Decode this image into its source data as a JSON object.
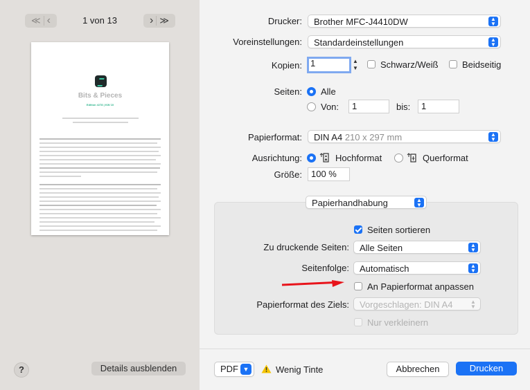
{
  "nav": {
    "first": "≪",
    "prev": "‹",
    "next": "›",
    "last": "≫",
    "page_indicator": "1 von 13"
  },
  "preview": {
    "title": "Bits & Pieces",
    "subtitle": "Edition #278 | KW 10"
  },
  "left_footer": {
    "help": "?",
    "details_button": "Details ausblenden"
  },
  "printer": {
    "label": "Drucker:",
    "value": "Brother MFC-J4410DW"
  },
  "presets": {
    "label": "Voreinstellungen:",
    "value": "Standardeinstellungen"
  },
  "copies": {
    "label": "Kopien:",
    "value": "1",
    "bw_label": "Schwarz/Weiß",
    "duplex_label": "Beidseitig"
  },
  "pages": {
    "label": "Seiten:",
    "all_label": "Alle",
    "from_label": "Von:",
    "from_value": "1",
    "to_label": "bis:",
    "to_value": "1"
  },
  "paper": {
    "label": "Papierformat:",
    "value": "DIN A4",
    "dims": "210 x 297 mm"
  },
  "orientation": {
    "label": "Ausrichtung:",
    "portrait": "Hochformat",
    "landscape": "Querformat"
  },
  "scale": {
    "label": "Größe:",
    "value": "100 %"
  },
  "section": {
    "value": "Papierhandhabung"
  },
  "handling": {
    "collate_label": "Seiten sortieren",
    "pages_to_print_label": "Zu druckende Seiten:",
    "pages_to_print_value": "Alle Seiten",
    "order_label": "Seitenfolge:",
    "order_value": "Automatisch",
    "fit_label": "An Papierformat anpassen",
    "target_label": "Papierformat des Ziels:",
    "target_value": "Vorgeschlagen: DIN A4",
    "shrink_label": "Nur verkleinern"
  },
  "footer": {
    "pdf": "PDF",
    "warning": "Wenig Tinte",
    "cancel": "Abbrechen",
    "print": "Drucken"
  },
  "colors": {
    "accent": "#1b72f5",
    "annotation_arrow": "#e8141b",
    "warning": "#f5c400"
  }
}
